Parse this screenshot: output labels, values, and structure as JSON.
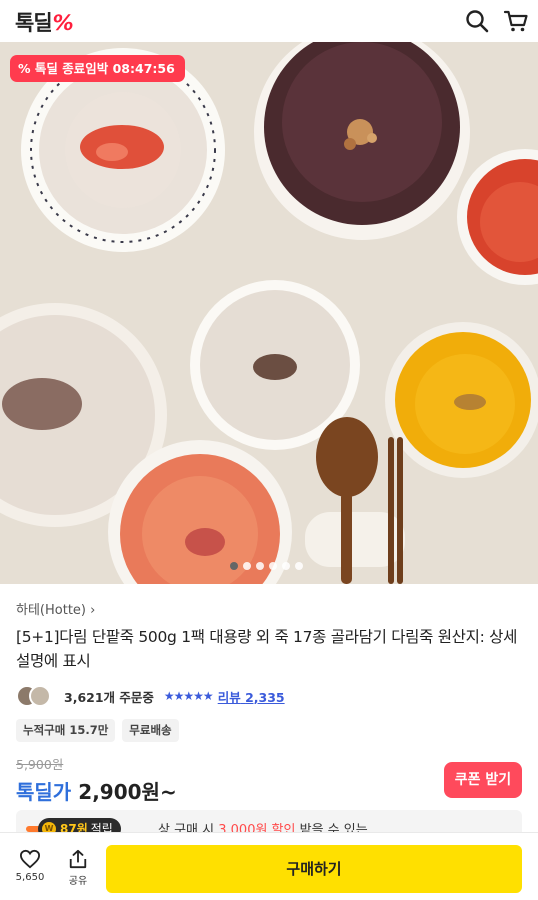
{
  "header": {
    "logo_text": "톡딜",
    "logo_mark": "%",
    "icons": [
      "search-icon",
      "cart-icon"
    ]
  },
  "hero": {
    "timer_prefix": "톡딜 종료임박",
    "timer_value": "08:47:56",
    "slide_count": 6,
    "active_slide": 1
  },
  "product": {
    "brand": "하테(Hotte)",
    "brand_chevron": "›",
    "title": "[5+1]다림 단팥죽 500g 1팩 대용량 외 죽 17종 골라담기 다림죽 원산지: 상세설명에 표시",
    "orders": "3,621개 주문중",
    "stars": "★★★★★",
    "review_label": "리뷰",
    "review_count": "2,335",
    "tags": [
      "누적구매 15.7만",
      "무료배송"
    ],
    "original_price": "5,900원",
    "price_label": "톡딜가",
    "price": "2,900원~",
    "coupon_label": "쿠폰 받기"
  },
  "promo": {
    "text_prefix": "상 구매 시",
    "highlight": "3,000원 할인",
    "text_suffix": "받을 수 있는"
  },
  "points": {
    "coin_label": "W",
    "amount": "87원",
    "label": "적립"
  },
  "bottom_bar": {
    "like_count": "5,650",
    "share_label": "공유",
    "buy_label": "구매하기"
  },
  "colors": {
    "accent_red": "#ff3b4e",
    "price_blue": "#2f6fdb",
    "buy_yellow": "#ffe000"
  }
}
